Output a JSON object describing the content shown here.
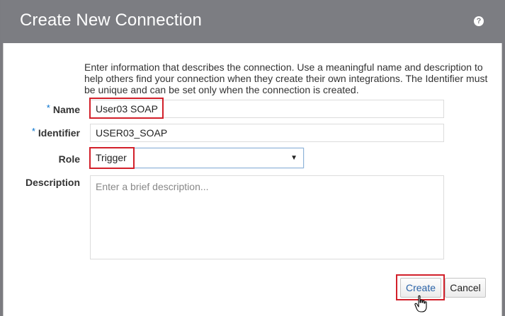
{
  "dialog": {
    "title": "Create New Connection",
    "help_icon": "help-icon",
    "intro": "Enter information that describes the connection. Use a meaningful name and description to help others find your connection when they create their own integrations. The Identifier must be unique and can be set only when the connection is created."
  },
  "form": {
    "name_label": "Name",
    "name_value": "User03 SOAP",
    "identifier_label": "Identifier",
    "identifier_value": "USER03_SOAP",
    "required_marker": "*",
    "role_label": "Role",
    "role_value": "Trigger",
    "description_label": "Description",
    "description_placeholder": "Enter a brief description..."
  },
  "buttons": {
    "create": "Create",
    "cancel": "Cancel"
  },
  "colors": {
    "titlebar": "#7c7d82",
    "highlight": "#d2202a",
    "required": "#0572ce"
  }
}
